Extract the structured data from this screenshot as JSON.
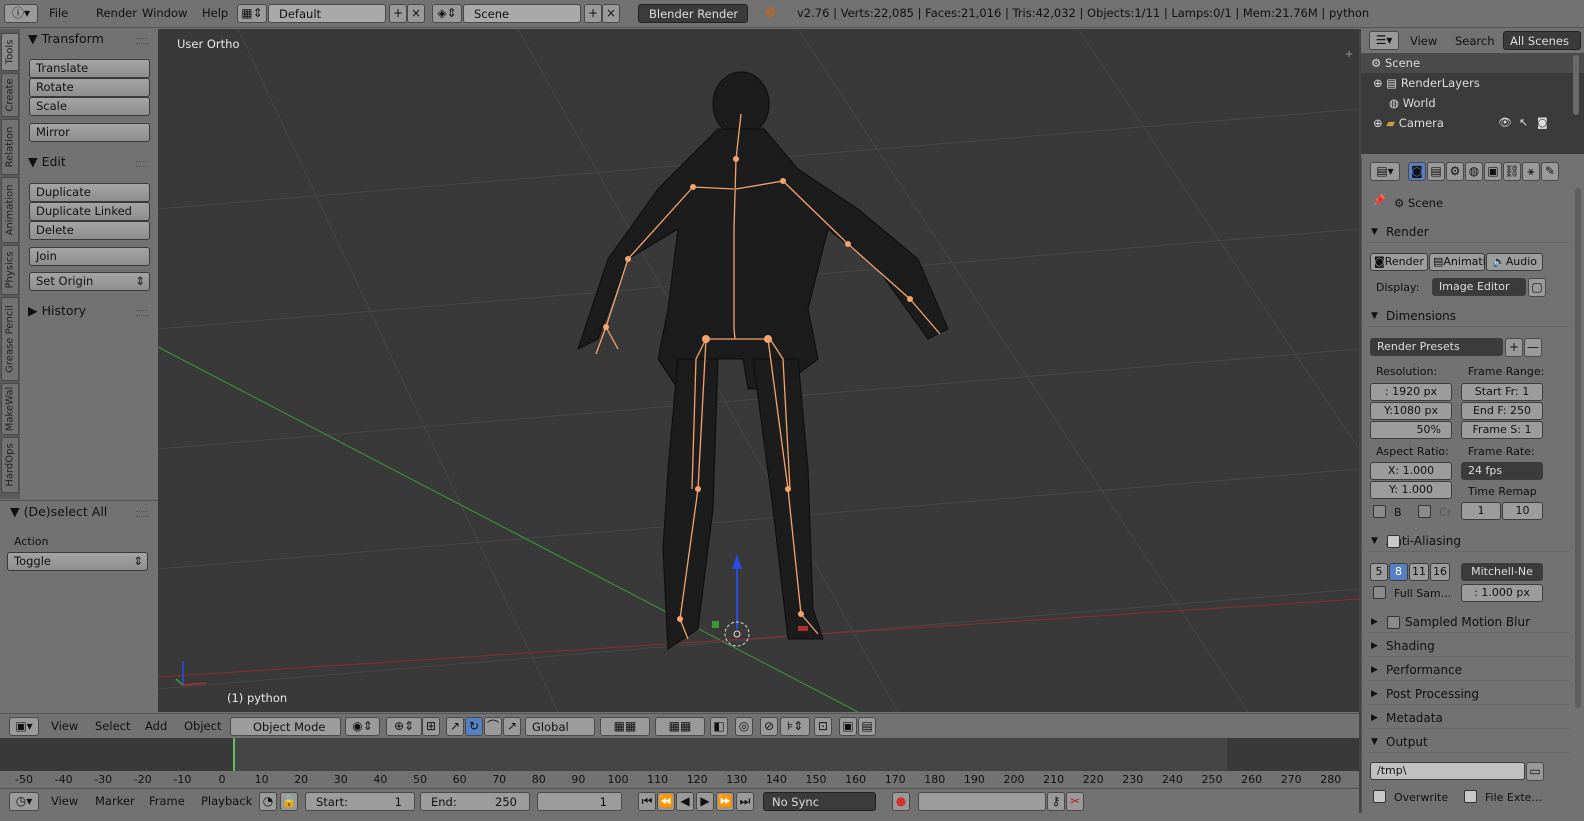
{
  "topbar": {
    "menus": [
      "File",
      "Render",
      "Window",
      "Help"
    ],
    "layout": "Default",
    "scene": "Scene",
    "engine": "Blender Render",
    "stats": "v2.76 | Verts:22,085 | Faces:21,016 | Tris:42,032 | Objects:1/11 | Lamps:0/1 | Mem:21.76M | python"
  },
  "left_tabs": [
    "Tools",
    "Create",
    "Relation",
    "Animation",
    "Physics",
    "Grease Pencil",
    "MakeWal",
    "HardOps"
  ],
  "tools": {
    "transform": "Transform",
    "translate": "Translate",
    "rotate": "Rotate",
    "scale": "Scale",
    "mirror": "Mirror",
    "edit": "Edit",
    "duplicate": "Duplicate",
    "duplicate_linked": "Duplicate Linked",
    "delete": "Delete",
    "join": "Join",
    "set_origin": "Set Origin",
    "history": "History"
  },
  "operator": {
    "title": "(De)select All",
    "action_label": "Action",
    "action_value": "Toggle"
  },
  "viewport": {
    "view_name": "User Ortho",
    "object_name": "(1) python"
  },
  "view_header": {
    "menus": [
      "View",
      "Select",
      "Add",
      "Object"
    ],
    "mode": "Object Mode",
    "orientation": "Global"
  },
  "timeline": {
    "ticks": [
      "-50",
      "-40",
      "-30",
      "-20",
      "-10",
      "0",
      "10",
      "20",
      "30",
      "40",
      "50",
      "60",
      "70",
      "80",
      "90",
      "100",
      "110",
      "120",
      "130",
      "140",
      "150",
      "160",
      "170",
      "180",
      "190",
      "200",
      "210",
      "220",
      "230",
      "240",
      "250",
      "260",
      "270",
      "280"
    ],
    "menus": [
      "View",
      "Marker",
      "Frame",
      "Playback"
    ],
    "start_label": "Start:",
    "start_value": "1",
    "end_label": "End:",
    "end_value": "250",
    "current": "1",
    "sync": "No Sync"
  },
  "outliner": {
    "menus": [
      "View",
      "Search"
    ],
    "filter": "All Scenes",
    "items": [
      "Scene",
      "RenderLayers",
      "World",
      "Camera"
    ]
  },
  "props": {
    "context": "Scene",
    "render": "Render",
    "tab_render": "Render",
    "tab_anim": "Animati",
    "tab_audio": "Audio",
    "display_label": "Display:",
    "display_value": "Image Editor",
    "dimensions": "Dimensions",
    "presets": "Render Presets",
    "resolution_label": "Resolution:",
    "res_x": ": 1920 px",
    "res_y": "Y:1080 px",
    "res_pct": "50%",
    "frame_range_label": "Frame Range:",
    "start_fr": "Start Fr: 1",
    "end_fr": "End F: 250",
    "frame_step": "Frame S: 1",
    "aspect_label": "Aspect Ratio:",
    "aspect_x": "X:  1.000",
    "aspect_y": "Y:  1.000",
    "frame_rate_label": "Frame Rate:",
    "fps": "24 fps",
    "time_remap": "Time Remap",
    "b_label": "B",
    "cr_label": "Cr",
    "remap_old": "1",
    "remap_new": "10",
    "aa": "Anti-Aliasing",
    "aa_samples": [
      "5",
      "8",
      "11",
      "16"
    ],
    "aa_filter": "Mitchell-Ne",
    "full_sample": "Full Sam...",
    "filter_size": ": 1.000 px",
    "motion_blur": "Sampled Motion Blur",
    "shading": "Shading",
    "performance": "Performance",
    "post_processing": "Post Processing",
    "metadata": "Metadata",
    "output": "Output",
    "output_path": "/tmp\\",
    "overwrite": "Overwrite",
    "file_ext": "File Exte..."
  },
  "colors": {
    "panel": "#727272",
    "viewport_bg": "#393939",
    "armature": "#f3a46e",
    "x_axis": "#b03030",
    "y_axis": "#3a9a3a",
    "z_axis": "#2a4ae0",
    "active_sample": "#5680c2"
  }
}
